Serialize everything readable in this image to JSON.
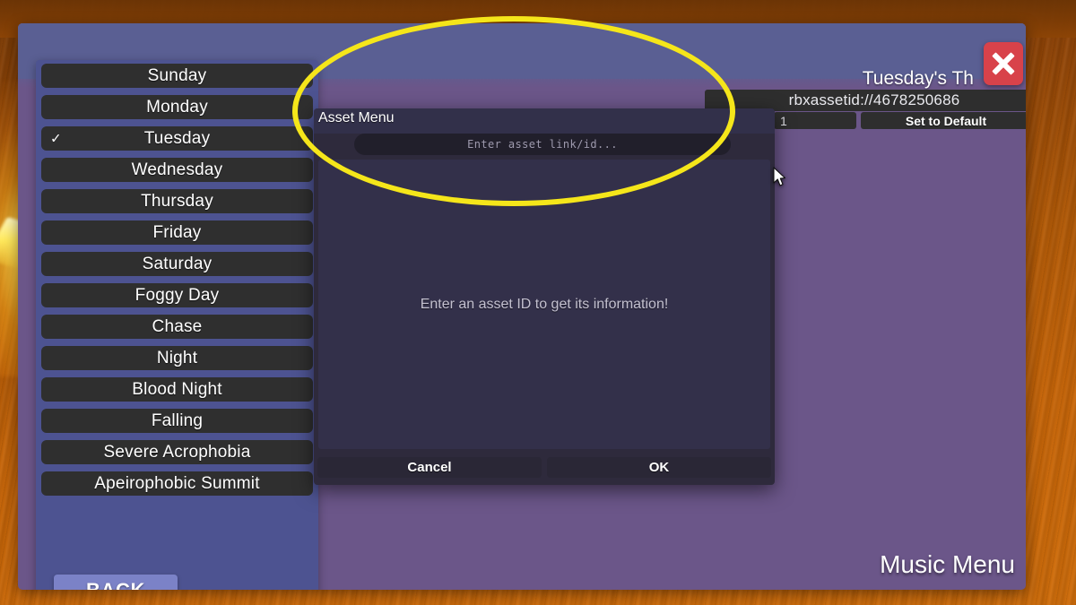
{
  "window": {
    "theme_title": "Tuesday's Th",
    "asset_id_value": "rbxassetid://4678250686",
    "quantity_value": "1",
    "set_default_label": "Set to Default",
    "close_icon": "close-x-icon",
    "footer_label": "Music Menu",
    "back_label": "BACK"
  },
  "theme_list": {
    "selected": "Tuesday",
    "check_glyph": "✓",
    "items": [
      {
        "label": "Sunday",
        "checked": false
      },
      {
        "label": "Monday",
        "checked": false
      },
      {
        "label": "Tuesday",
        "checked": true
      },
      {
        "label": "Wednesday",
        "checked": false
      },
      {
        "label": "Thursday",
        "checked": false
      },
      {
        "label": "Friday",
        "checked": false
      },
      {
        "label": "Saturday",
        "checked": false
      },
      {
        "label": "Foggy Day",
        "checked": false
      },
      {
        "label": "Chase",
        "checked": false
      },
      {
        "label": "Night",
        "checked": false
      },
      {
        "label": "Blood Night",
        "checked": false
      },
      {
        "label": "Falling",
        "checked": false
      },
      {
        "label": "Severe Acrophobia",
        "checked": false
      },
      {
        "label": "Apeirophobic Summit",
        "checked": false
      }
    ]
  },
  "asset_dialog": {
    "title": "Asset Menu",
    "input_value": "",
    "input_placeholder": "Enter asset link/id...",
    "body_message": "Enter an asset ID to get its information!",
    "cancel_label": "Cancel",
    "ok_label": "OK"
  },
  "annotation": {
    "shape": "ellipse",
    "color": "#f5e61a"
  },
  "colors": {
    "panel_purple": "#6b5689",
    "list_panel_blue": "#4d5391",
    "list_item_dark": "#2f2f2f",
    "dialog_bg": "#2e2a3c",
    "dialog_body": "#33304a",
    "back_button": "#7b82c7",
    "close_red": "#d8424a",
    "annotation_yellow": "#f5e61a",
    "desk_orange": "#b35a06"
  }
}
